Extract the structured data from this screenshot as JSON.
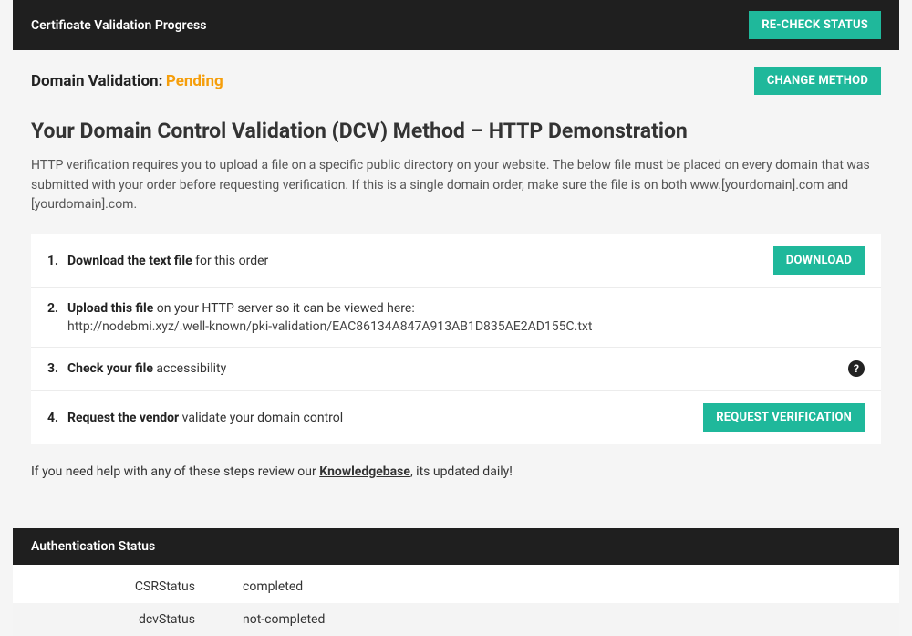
{
  "header": {
    "title": "Certificate Validation Progress",
    "recheck_label": "RE-CHECK STATUS"
  },
  "validation": {
    "label": "Domain Validation:",
    "status": "Pending",
    "change_method_label": "CHANGE METHOD"
  },
  "dcv": {
    "title": "Your Domain Control Validation (DCV) Method – HTTP Demonstration",
    "description": "HTTP verification requires you to upload a file on a specific public directory on your website. The below file must be placed on every domain that was submitted with your order before requesting verification. If this is a single domain order, make sure the file is on both www.[yourdomain].com and [yourdomain].com."
  },
  "steps": {
    "s1": {
      "num": "1.",
      "bold": "Download the text file",
      "rest": " for this order",
      "button": "DOWNLOAD"
    },
    "s2": {
      "num": "2.",
      "bold": "Upload this file",
      "rest": " on your HTTP server so it can be viewed here:",
      "url": "http://nodebmi.xyz/.well-known/pki-validation/EAC86134A847A913AB1D835AE2AD155C.txt"
    },
    "s3": {
      "num": "3.",
      "bold": "Check your file",
      "rest": " accessibility"
    },
    "s4": {
      "num": "4.",
      "bold": "Request the vendor",
      "rest": " validate your domain control",
      "button": "REQUEST VERIFICATION"
    }
  },
  "footnote": {
    "prefix": "If you need help with any of these steps review our ",
    "link": "Knowledgebase",
    "suffix": ", its updated daily!"
  },
  "auth": {
    "title": "Authentication Status",
    "rows": [
      {
        "label": "CSRStatus",
        "value": "completed"
      },
      {
        "label": "dcvStatus",
        "value": "not-completed"
      }
    ]
  }
}
